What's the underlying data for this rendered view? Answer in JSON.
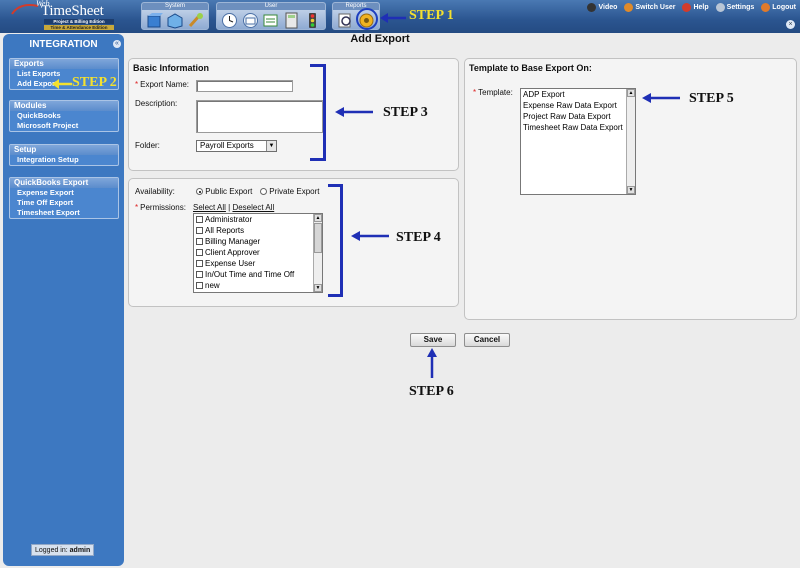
{
  "header": {
    "logo": {
      "web": "Web",
      "main": "TimeSheet",
      "edition1": "Project & Billing Edition",
      "edition2": "Time & Attendance Edition"
    },
    "groups": [
      {
        "label": "System",
        "icons": [
          "system-cube-icon",
          "system-box-icon",
          "system-tools-icon"
        ]
      },
      {
        "label": "User",
        "icons": [
          "clock-icon",
          "mail-icon",
          "notes-icon",
          "calculator-icon",
          "traffic-light-icon"
        ]
      },
      {
        "label": "Reports",
        "icons": [
          "report-magnifier-icon",
          "integration-gear-icon"
        ]
      }
    ],
    "links": [
      {
        "label": "Video",
        "color": "#333333"
      },
      {
        "label": "Switch User",
        "color": "#e08a2a"
      },
      {
        "label": "Help",
        "color": "#d23b2b"
      },
      {
        "label": "Settings",
        "color": "#b9c6d6"
      },
      {
        "label": "Logout",
        "color": "#e07a2a"
      }
    ]
  },
  "sidebar": {
    "title": "INTEGRATION",
    "sections": [
      {
        "heading": "Exports",
        "items": [
          "List Exports",
          "Add Export"
        ]
      },
      {
        "heading": "Modules",
        "items": [
          "QuickBooks",
          "Microsoft Project"
        ]
      },
      {
        "heading": "Setup",
        "items": [
          "Integration Setup"
        ]
      },
      {
        "heading": "QuickBooks Export",
        "items": [
          "Expense Export",
          "Time Off Export",
          "Timesheet Export"
        ]
      }
    ],
    "logged_in_label": "Logged in:",
    "logged_in_user": "admin"
  },
  "page": {
    "title": "Add Export"
  },
  "basic_info": {
    "title": "Basic Information",
    "export_name_label": "Export Name:",
    "export_name_value": "",
    "description_label": "Description:",
    "description_value": "",
    "folder_label": "Folder:",
    "folder_value": "Payroll Exports"
  },
  "availability": {
    "label": "Availability:",
    "public": "Public Export",
    "private": "Private Export",
    "selected": "public",
    "permissions_label": "Permissions:",
    "select_all": "Select All",
    "separator": "|",
    "deselect_all": "Deselect All",
    "permissions": [
      "Administrator",
      "All Reports",
      "Billing Manager",
      "Client Approver",
      "Expense User",
      "In/Out Time and Time Off",
      "new"
    ]
  },
  "template": {
    "title": "Template to Base Export On:",
    "label": "Template:",
    "options": [
      "ADP Export",
      "Expense Raw Data Export",
      "Project Raw Data Export",
      "Timesheet Raw Data Export"
    ]
  },
  "actions": {
    "save": "Save",
    "cancel": "Cancel"
  },
  "steps": {
    "step1": "STEP 1",
    "step2": "STEP 2",
    "step3": "STEP 3",
    "step4": "STEP 4",
    "step5": "STEP 5",
    "step6": "STEP 6",
    "accent_yellow": "#f4e12e",
    "accent_blue": "#1f2fb5"
  }
}
